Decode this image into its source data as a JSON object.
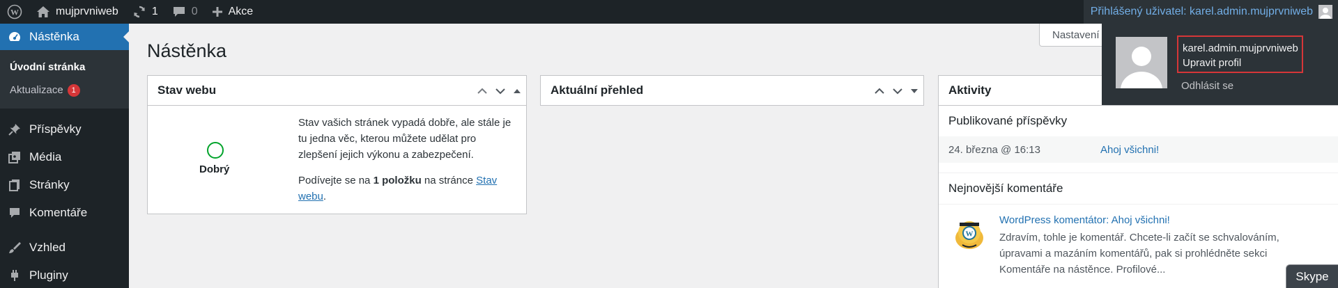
{
  "admin_bar": {
    "wp_logo_icon": "wordpress-icon",
    "site_name": "mujprvniweb",
    "updates_count": "1",
    "comments_count": "0",
    "new_label": "Akce",
    "greeting": "Přihlášený uživatel: karel.admin.mujprvniweb"
  },
  "sidebar": {
    "dashboard": "Nástěnka",
    "sub_home": "Úvodní stránka",
    "sub_updates": "Aktualizace",
    "updates_badge": "1",
    "posts": "Příspěvky",
    "media": "Média",
    "pages": "Stránky",
    "comments": "Komentáře",
    "appearance": "Vzhled",
    "plugins": "Pluginy"
  },
  "main": {
    "page_title": "Nástěnka",
    "screen_options": "Nastavení zobrazení"
  },
  "site_health": {
    "title": "Stav webu",
    "status": "Dobrý",
    "text1": "Stav vašich stránek vypadá dobře, ale stále je tu jedna věc, kterou můžete udělat pro zlepšení jejich výkonu a zabezpečení.",
    "text2_pre": "Podívejte se na ",
    "text2_bold": "1 položku",
    "text2_mid": " na stránce ",
    "text2_link": "Stav webu",
    "text2_end": "."
  },
  "at_a_glance": {
    "title": "Aktuální přehled"
  },
  "activity": {
    "title": "Aktivity",
    "published_title": "Publikované příspěvky",
    "post_date": "24. března @ 16:13",
    "post_link": "Ahoj všichni!",
    "comments_title": "Nejnovější komentáře",
    "comment_meta": "WordPress komentátor: Ahoj všichni!",
    "comment_text": "Zdravím, tohle je komentář. Chcete-li začít se schvalováním, úpravami a mazáním komentářů, pak si prohlédněte sekci Komentáře na nástěnce. Profilové..."
  },
  "account_menu": {
    "username": "karel.admin.mujprvniweb",
    "edit_profile": "Upravit profil",
    "logout": "Odhlásit se",
    "highlight_color": "#d63638"
  },
  "skype": {
    "label": "Skype"
  },
  "colors": {
    "admin_bar": "#1d2327",
    "accent": "#2271b1",
    "health_good": "#00a32a",
    "badge": "#d63638"
  }
}
